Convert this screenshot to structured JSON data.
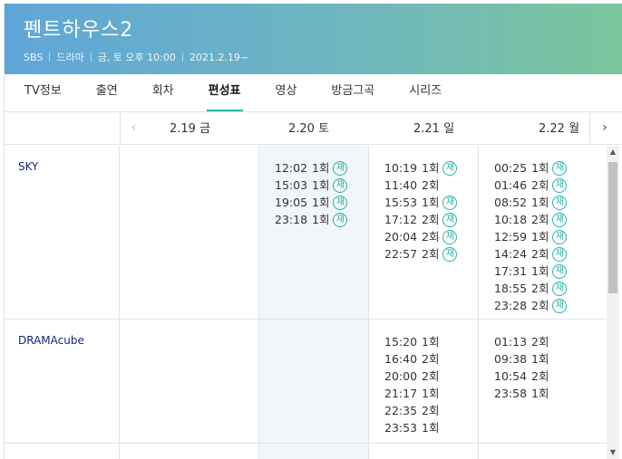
{
  "program": {
    "title": "펜트하우스2",
    "meta": [
      "SBS",
      "드라마",
      "금, 토 오후 10:00",
      "2021.2.19~"
    ]
  },
  "tabs": [
    {
      "label": "TV정보"
    },
    {
      "label": "출연"
    },
    {
      "label": "회차"
    },
    {
      "label": "편성표",
      "active": true
    },
    {
      "label": "영상"
    },
    {
      "label": "방금그곡"
    },
    {
      "label": "시리즈"
    }
  ],
  "dates": [
    {
      "date": "2.19",
      "day": "금"
    },
    {
      "date": "2.20",
      "day": "토"
    },
    {
      "date": "2.21",
      "day": "일"
    },
    {
      "date": "2.22",
      "day": "월"
    }
  ],
  "nav": {
    "prev_icon": "‹",
    "next_icon": "›"
  },
  "rebroadcast_badge": "재",
  "channels": [
    {
      "name": "SKY",
      "days": [
        [],
        [
          {
            "time": "12:02",
            "ep": "1회",
            "re": true
          },
          {
            "time": "15:03",
            "ep": "1회",
            "re": true
          },
          {
            "time": "19:05",
            "ep": "1회",
            "re": true
          },
          {
            "time": "23:18",
            "ep": "1회",
            "re": true
          }
        ],
        [
          {
            "time": "10:19",
            "ep": "1회",
            "re": true
          },
          {
            "time": "11:40",
            "ep": "2회",
            "re": false
          },
          {
            "time": "15:53",
            "ep": "1회",
            "re": true
          },
          {
            "time": "17:12",
            "ep": "2회",
            "re": true
          },
          {
            "time": "20:04",
            "ep": "2회",
            "re": true
          },
          {
            "time": "22:57",
            "ep": "2회",
            "re": true
          }
        ],
        [
          {
            "time": "00:25",
            "ep": "1회",
            "re": true
          },
          {
            "time": "01:46",
            "ep": "2회",
            "re": true
          },
          {
            "time": "08:52",
            "ep": "1회",
            "re": true
          },
          {
            "time": "10:18",
            "ep": "2회",
            "re": true
          },
          {
            "time": "12:59",
            "ep": "1회",
            "re": true
          },
          {
            "time": "14:24",
            "ep": "2회",
            "re": true
          },
          {
            "time": "17:31",
            "ep": "1회",
            "re": true
          },
          {
            "time": "18:55",
            "ep": "2회",
            "re": true
          },
          {
            "time": "23:28",
            "ep": "2회",
            "re": true
          }
        ]
      ]
    },
    {
      "name": "DRAMAcube",
      "days": [
        [],
        [],
        [
          {
            "time": "15:20",
            "ep": "1회",
            "re": false
          },
          {
            "time": "16:40",
            "ep": "2회",
            "re": false
          },
          {
            "time": "20:00",
            "ep": "2회",
            "re": false
          },
          {
            "time": "21:17",
            "ep": "1회",
            "re": false
          },
          {
            "time": "22:35",
            "ep": "2회",
            "re": false
          },
          {
            "time": "23:53",
            "ep": "1회",
            "re": false
          }
        ],
        [
          {
            "time": "01:13",
            "ep": "2회",
            "re": false
          },
          {
            "time": "09:38",
            "ep": "1회",
            "re": false
          },
          {
            "time": "10:54",
            "ep": "2회",
            "re": false
          },
          {
            "time": "23:58",
            "ep": "1회",
            "re": false
          }
        ]
      ]
    }
  ],
  "scrollbar": {
    "up_icon": "▲",
    "down_icon": "▼"
  }
}
